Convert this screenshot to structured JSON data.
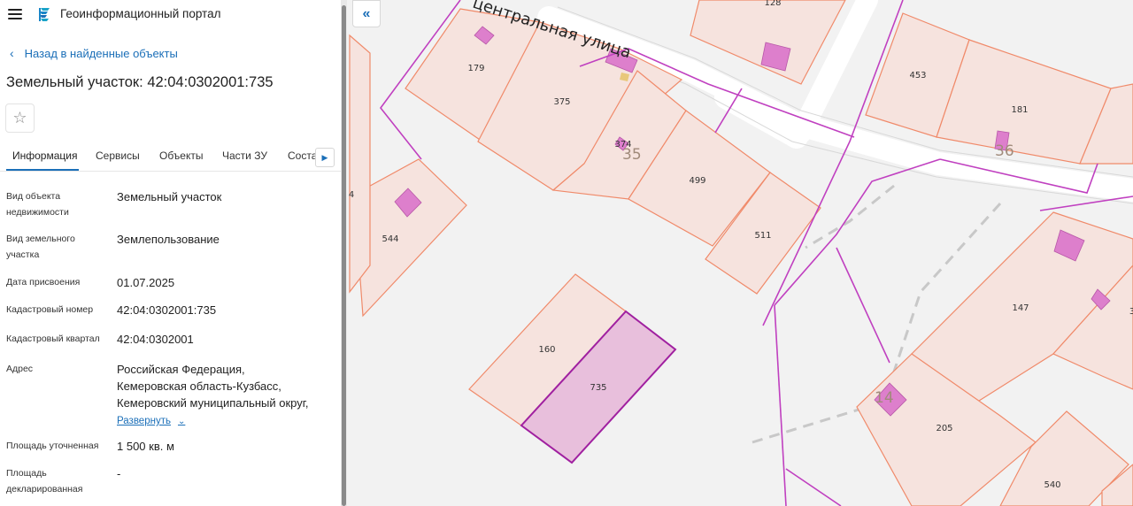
{
  "header": {
    "title": "Геоинформационный портал"
  },
  "nav": {
    "back_label": "Назад в найденные объекты"
  },
  "object": {
    "title": "Земельный участок: 42:04:0302001:735"
  },
  "tabs": [
    {
      "label": "Информация"
    },
    {
      "label": "Сервисы"
    },
    {
      "label": "Объекты"
    },
    {
      "label": "Части ЗУ"
    },
    {
      "label": "Состав"
    }
  ],
  "info": {
    "type": {
      "label": "Вид объекта недвижимости",
      "value": "Земельный участок"
    },
    "land_type": {
      "label": "Вид земельного участка",
      "value": "Землепользование"
    },
    "date": {
      "label": "Дата присвоения",
      "value": "01.07.2025"
    },
    "cad_number": {
      "label": "Кадастровый номер",
      "value": "42:04:0302001:735"
    },
    "cad_quarter": {
      "label": "Кадастровый квартал",
      "value": "42:04:0302001"
    },
    "address": {
      "label": "Адрес",
      "lines": [
        "Российская Федерация,",
        "Кемеровская область-Кузбасс,",
        "Кемеровский муниципальный округ,"
      ],
      "expand_label": "Развернуть"
    },
    "area_refined": {
      "label": "Площадь уточненная",
      "value": "1 500 кв. м"
    },
    "area_declared": {
      "label": "Площадь декларированная",
      "value": "-"
    }
  },
  "map": {
    "street_name": "центральная улица",
    "parcels": [
      "128",
      "179",
      "375",
      "374",
      "453",
      "181",
      "499",
      "511",
      "544",
      "160",
      "735",
      "147",
      "205",
      "540",
      "4",
      "3"
    ],
    "blocks": [
      "35",
      "36",
      "14"
    ],
    "colors": {
      "parcel_fill": "#f6e3de",
      "parcel_stroke": "#f08a6a",
      "selected_fill": "#e8bfdc",
      "selected_stroke": "#a020a0",
      "building_fill": "#dd7fcc",
      "boundary_line": "#c040c0"
    }
  }
}
